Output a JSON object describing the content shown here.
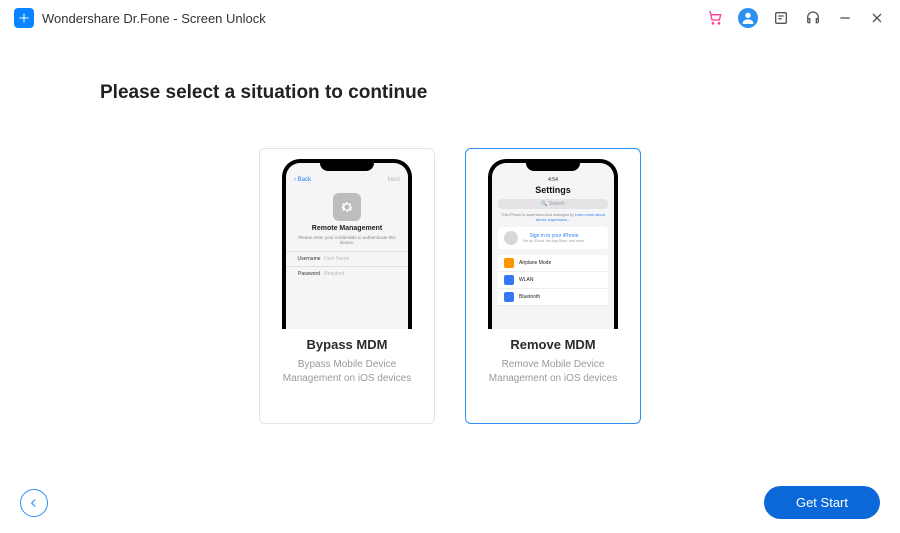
{
  "app": {
    "title": "Wondershare Dr.Fone - Screen Unlock"
  },
  "heading": "Please select a situation to continue",
  "cards": {
    "bypass": {
      "title": "Bypass MDM",
      "desc": "Bypass Mobile Device Management on iOS devices",
      "screen": {
        "back": "Back",
        "next": "Next",
        "title": "Remote Management",
        "sub": "Please enter your credentials to authenticate this device.",
        "username_label": "Username",
        "username_placeholder": "User Name",
        "password_label": "Password",
        "password_placeholder": "Required"
      }
    },
    "remove": {
      "title": "Remove MDM",
      "desc": "Remove Mobile Device Management on iOS devices",
      "screen": {
        "time": "4:54",
        "title": "Settings",
        "search": "Search",
        "notice_prefix": "This iPhone is supervised and managed by",
        "notice_link": "Learn more about device supervision...",
        "profile_title": "Sign in to your iPhone",
        "profile_sub": "Set up iCloud, the App Store, and more.",
        "rows": {
          "airplane": "Airplane Mode",
          "wlan": "WLAN",
          "bluetooth": "Bluetooth"
        }
      }
    }
  },
  "footer": {
    "start": "Get Start"
  }
}
